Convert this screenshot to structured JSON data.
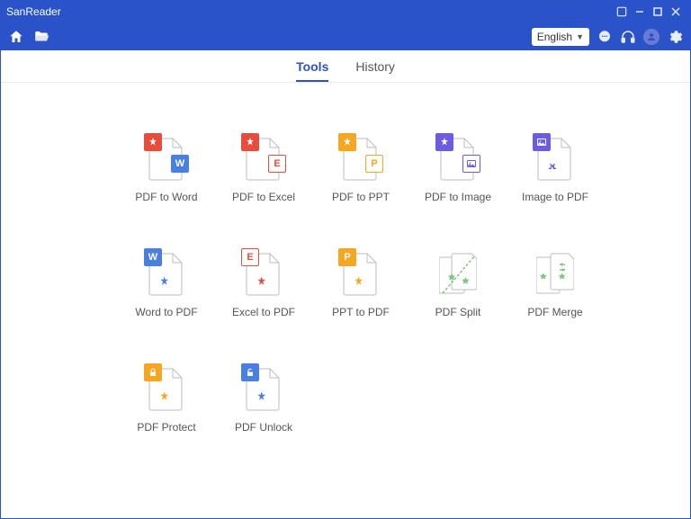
{
  "app": {
    "title": "SanReader"
  },
  "toolbar": {
    "language": "English"
  },
  "tabs": {
    "tools": "Tools",
    "history": "History",
    "active": "tools"
  },
  "tools": {
    "pdf_to_word": "PDF to Word",
    "pdf_to_excel": "PDF to Excel",
    "pdf_to_ppt": "PDF to PPT",
    "pdf_to_image": "PDF to Image",
    "image_to_pdf": "Image to PDF",
    "word_to_pdf": "Word to PDF",
    "excel_to_pdf": "Excel to PDF",
    "ppt_to_pdf": "PPT to PDF",
    "pdf_split": "PDF Split",
    "pdf_merge": "PDF Merge",
    "pdf_protect": "PDF Protect",
    "pdf_unlock": "PDF Unlock"
  },
  "colors": {
    "pdf": "#E74C3C",
    "word": "#4A7FE0",
    "excel": "#E74C3C",
    "ppt": "#F5A623",
    "image": "#6B5CE0",
    "protect": "#F5A623",
    "unlock": "#4A7FE0",
    "outline": "#9aa0a6"
  }
}
